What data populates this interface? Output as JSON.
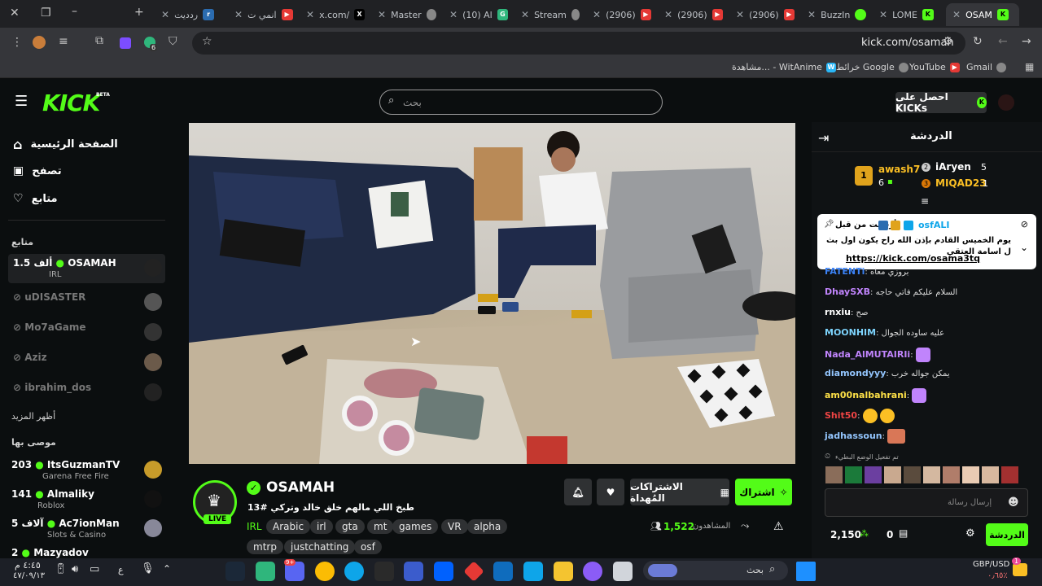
{
  "browser": {
    "tabs": [
      {
        "label": "ردديت",
        "icon": "reddit-icon"
      },
      {
        "label": "انمي ت",
        "icon": "youtube-icon"
      },
      {
        "label": "x.com/",
        "icon": "x-icon"
      },
      {
        "label": "Master",
        "icon": "globe-icon"
      },
      {
        "label": "(10) Al",
        "icon": "app-icon"
      },
      {
        "label": "Stream",
        "icon": "globe-icon"
      },
      {
        "label": "(2906)",
        "icon": "youtube-icon"
      },
      {
        "label": "(2906)",
        "icon": "youtube-icon"
      },
      {
        "label": "(2906)",
        "icon": "youtube-icon"
      },
      {
        "label": "BuzzIn",
        "icon": "green-dot-icon"
      },
      {
        "label": "LOME",
        "icon": "kick-icon"
      },
      {
        "label": "OSAM",
        "icon": "kick-icon"
      }
    ],
    "url": "kick.com/osamah",
    "extension_badge": "6",
    "bookmarks": [
      "Gmail",
      "YouTube",
      "خرائط Google",
      "مشاهدة... - WitAnime"
    ]
  },
  "kick": {
    "logo": "KICK",
    "beta": "BETA",
    "search_placeholder": "بحث",
    "get_kicks": "احصل على KICKs"
  },
  "sidebar": {
    "nav": [
      "الصفحة الرئيسية",
      "تصفح",
      "متابع"
    ],
    "following_header": "متابع",
    "following": [
      {
        "name": "OSAMAH",
        "viewers": "1.5 ألف",
        "category": "IRL",
        "live": true
      },
      {
        "name": "uDISASTER",
        "live": false
      },
      {
        "name": "Mo7aGame",
        "live": false
      },
      {
        "name": "Aziz",
        "live": false
      },
      {
        "name": "ibrahim_dos",
        "live": false
      }
    ],
    "show_more": "أظهر المزيد",
    "recommended_header": "موصى بها",
    "recommended": [
      {
        "name": "ItsGuzmanTV",
        "viewers": "203",
        "category": "Garena Free Fire"
      },
      {
        "name": "Almaliky",
        "viewers": "141",
        "category": "Roblox"
      },
      {
        "name": "Ac7ionMan",
        "viewers": "5 آلاف",
        "category": "Slots & Casino"
      },
      {
        "name": "Mazyadov",
        "viewers": "2",
        "category": ""
      }
    ]
  },
  "stream": {
    "streamer": "OSAMAH",
    "live_badge": "LIVE",
    "title": "طبخ اللي مالهم خلق خالد وتركي #13",
    "category": "IRL",
    "tags": [
      "Arabic",
      "irl",
      "gta",
      "mt",
      "games",
      "VR",
      "alpha",
      "mtrp",
      "justchatting",
      "osf"
    ],
    "subscribe": "اشتراك",
    "gift_subs": "الاشتراكات المُهداة",
    "viewers_label": "المشاهدون",
    "viewers": "1,522"
  },
  "chat": {
    "title": "الدردشة",
    "leaderboard": [
      {
        "rank": "1",
        "name": "awash7",
        "count": "6"
      },
      {
        "rank": "2",
        "name": "iAryen",
        "count": "5"
      },
      {
        "rank": "3",
        "name": "MIQAD23",
        "count": "1"
      }
    ],
    "pinned": {
      "label": "أرسلت من قبل",
      "user": "osfALI",
      "text": "يوم الخميس القادم بإذن الله راح يكون اول بث ل اسامة العتقي",
      "link": "https://kick.com/osama3tq"
    },
    "messages": [
      {
        "user": "FATENTi",
        "text": "بروزي معاه",
        "color": "#3b82f6"
      },
      {
        "user": "DhaySXB",
        "text": "السلام عليكم فاتي حاجه",
        "color": "#c084fc"
      },
      {
        "user": "rnxiu",
        "text": "صح",
        "color": "#ffffff"
      },
      {
        "user": "MOONHIM",
        "text": "عليه ساوده الجوال",
        "color": "#7dd3fc"
      },
      {
        "user": "Nada_AlMUTAIRIi",
        "text": "",
        "color": "#c084fc"
      },
      {
        "user": "diamondyyy",
        "text": "يمكن جواله خرب",
        "color": "#93c5fd"
      },
      {
        "user": "am00nalbahrani",
        "text": "",
        "color": "#fde047"
      },
      {
        "user": "Shit50",
        "text": "",
        "color": "#ef4444"
      },
      {
        "user": "jadhassoun",
        "text": "",
        "color": "#93c5fd"
      }
    ],
    "slow_mode": "تم تفعيل الوضع البطيء",
    "input_placeholder": "إرسال رسالة",
    "points": "2,150",
    "kicks": "0",
    "send": "الدردشة"
  },
  "taskbar": {
    "search": "بحث",
    "time": "٤:٤٥ م",
    "date": "٤٧/٠٩/١٣",
    "currency": "GBP/USD",
    "currency_change": "٠٫٦٥٪",
    "lang": "ع",
    "discord_badge": "9+",
    "weather_badge": "1"
  },
  "colors": {
    "kick_green": "#53fc18",
    "bg": "#0b0e0f"
  }
}
